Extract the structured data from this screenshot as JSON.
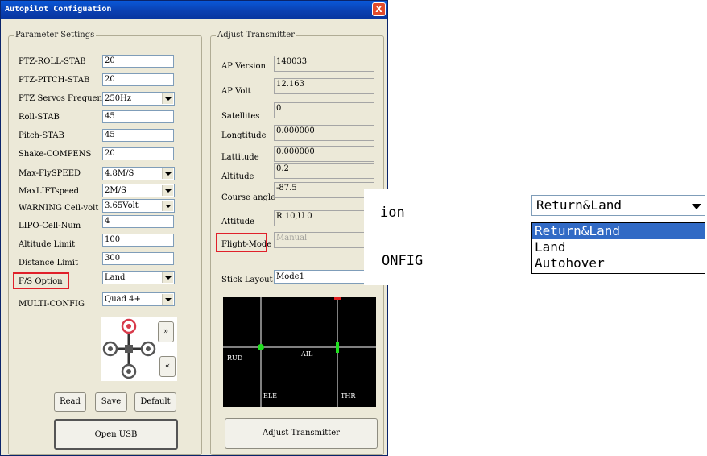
{
  "window": {
    "title": "Autopilot Configuation",
    "close_glyph": "X"
  },
  "param_group": {
    "label": "Parameter Settings"
  },
  "params": [
    {
      "label": "PTZ-ROLL-STAB",
      "value": "20",
      "type": "text"
    },
    {
      "label": "PTZ-PITCH-STAB",
      "value": "20",
      "type": "text"
    },
    {
      "label": "PTZ Servos Frequency",
      "value": "250Hz",
      "type": "select"
    },
    {
      "label": "Roll-STAB",
      "value": "45",
      "type": "text"
    },
    {
      "label": "Pitch-STAB",
      "value": "45",
      "type": "text"
    },
    {
      "label": "Shake-COMPENS",
      "value": "20",
      "type": "text"
    },
    {
      "label": "Max-FlySPEED",
      "value": "4.8M/S",
      "type": "select"
    },
    {
      "label": "MaxLIFTspeed",
      "value": "2M/S",
      "type": "select"
    },
    {
      "label": "WARNING Cell-volt",
      "value": "3.65Volt",
      "type": "select"
    },
    {
      "label": "LIPO-Cell-Num",
      "value": "4",
      "type": "text"
    },
    {
      "label": "Altitude Limit",
      "value": "100",
      "type": "text"
    },
    {
      "label": "Distance Limit",
      "value": "300",
      "type": "text"
    },
    {
      "label": "F/S Option",
      "value": "Land",
      "type": "select"
    },
    {
      "label": "MULTI-CONFIG",
      "value": "Quad 4+",
      "type": "select"
    }
  ],
  "nav": {
    "next": "»",
    "prev": "«"
  },
  "buttons": {
    "read": "Read",
    "save": "Save",
    "default": "Default",
    "open_usb": "Open USB",
    "adjust_transmitter": "Adjust Transmitter"
  },
  "adjust_group": {
    "label": "Adjust Transmitter"
  },
  "status": [
    {
      "label": "AP Version",
      "value": "140033"
    },
    {
      "label": "AP Volt",
      "value": "12.163"
    },
    {
      "label": "Satellites",
      "value": "0"
    },
    {
      "label": "Longtitude",
      "value": "0.000000"
    },
    {
      "label": "Lattitude",
      "value": "0.000000"
    },
    {
      "label": "Altitude",
      "value": "0.2"
    },
    {
      "label": "Course angle",
      "value": "-87.5"
    },
    {
      "label": "Attitude",
      "value": "R 10,U 0"
    },
    {
      "label": "Flight-Mode",
      "value": "Manual"
    }
  ],
  "stick_layout": {
    "label": "Stick Layout",
    "value": "Mode1"
  },
  "stick_display": {
    "rud": "RUD",
    "ail": "AIL",
    "ele": "ELE",
    "thr": "THR"
  },
  "zoom": {
    "label_top": "ion",
    "label_bottom": "ONFIG",
    "selected": "Return&Land",
    "options": [
      "Return&Land",
      "Land",
      "Autohover"
    ]
  },
  "colors": {
    "highlight_box": "#e0202a",
    "stick_dot": "#20e020",
    "list_selection": "#316ac5"
  }
}
